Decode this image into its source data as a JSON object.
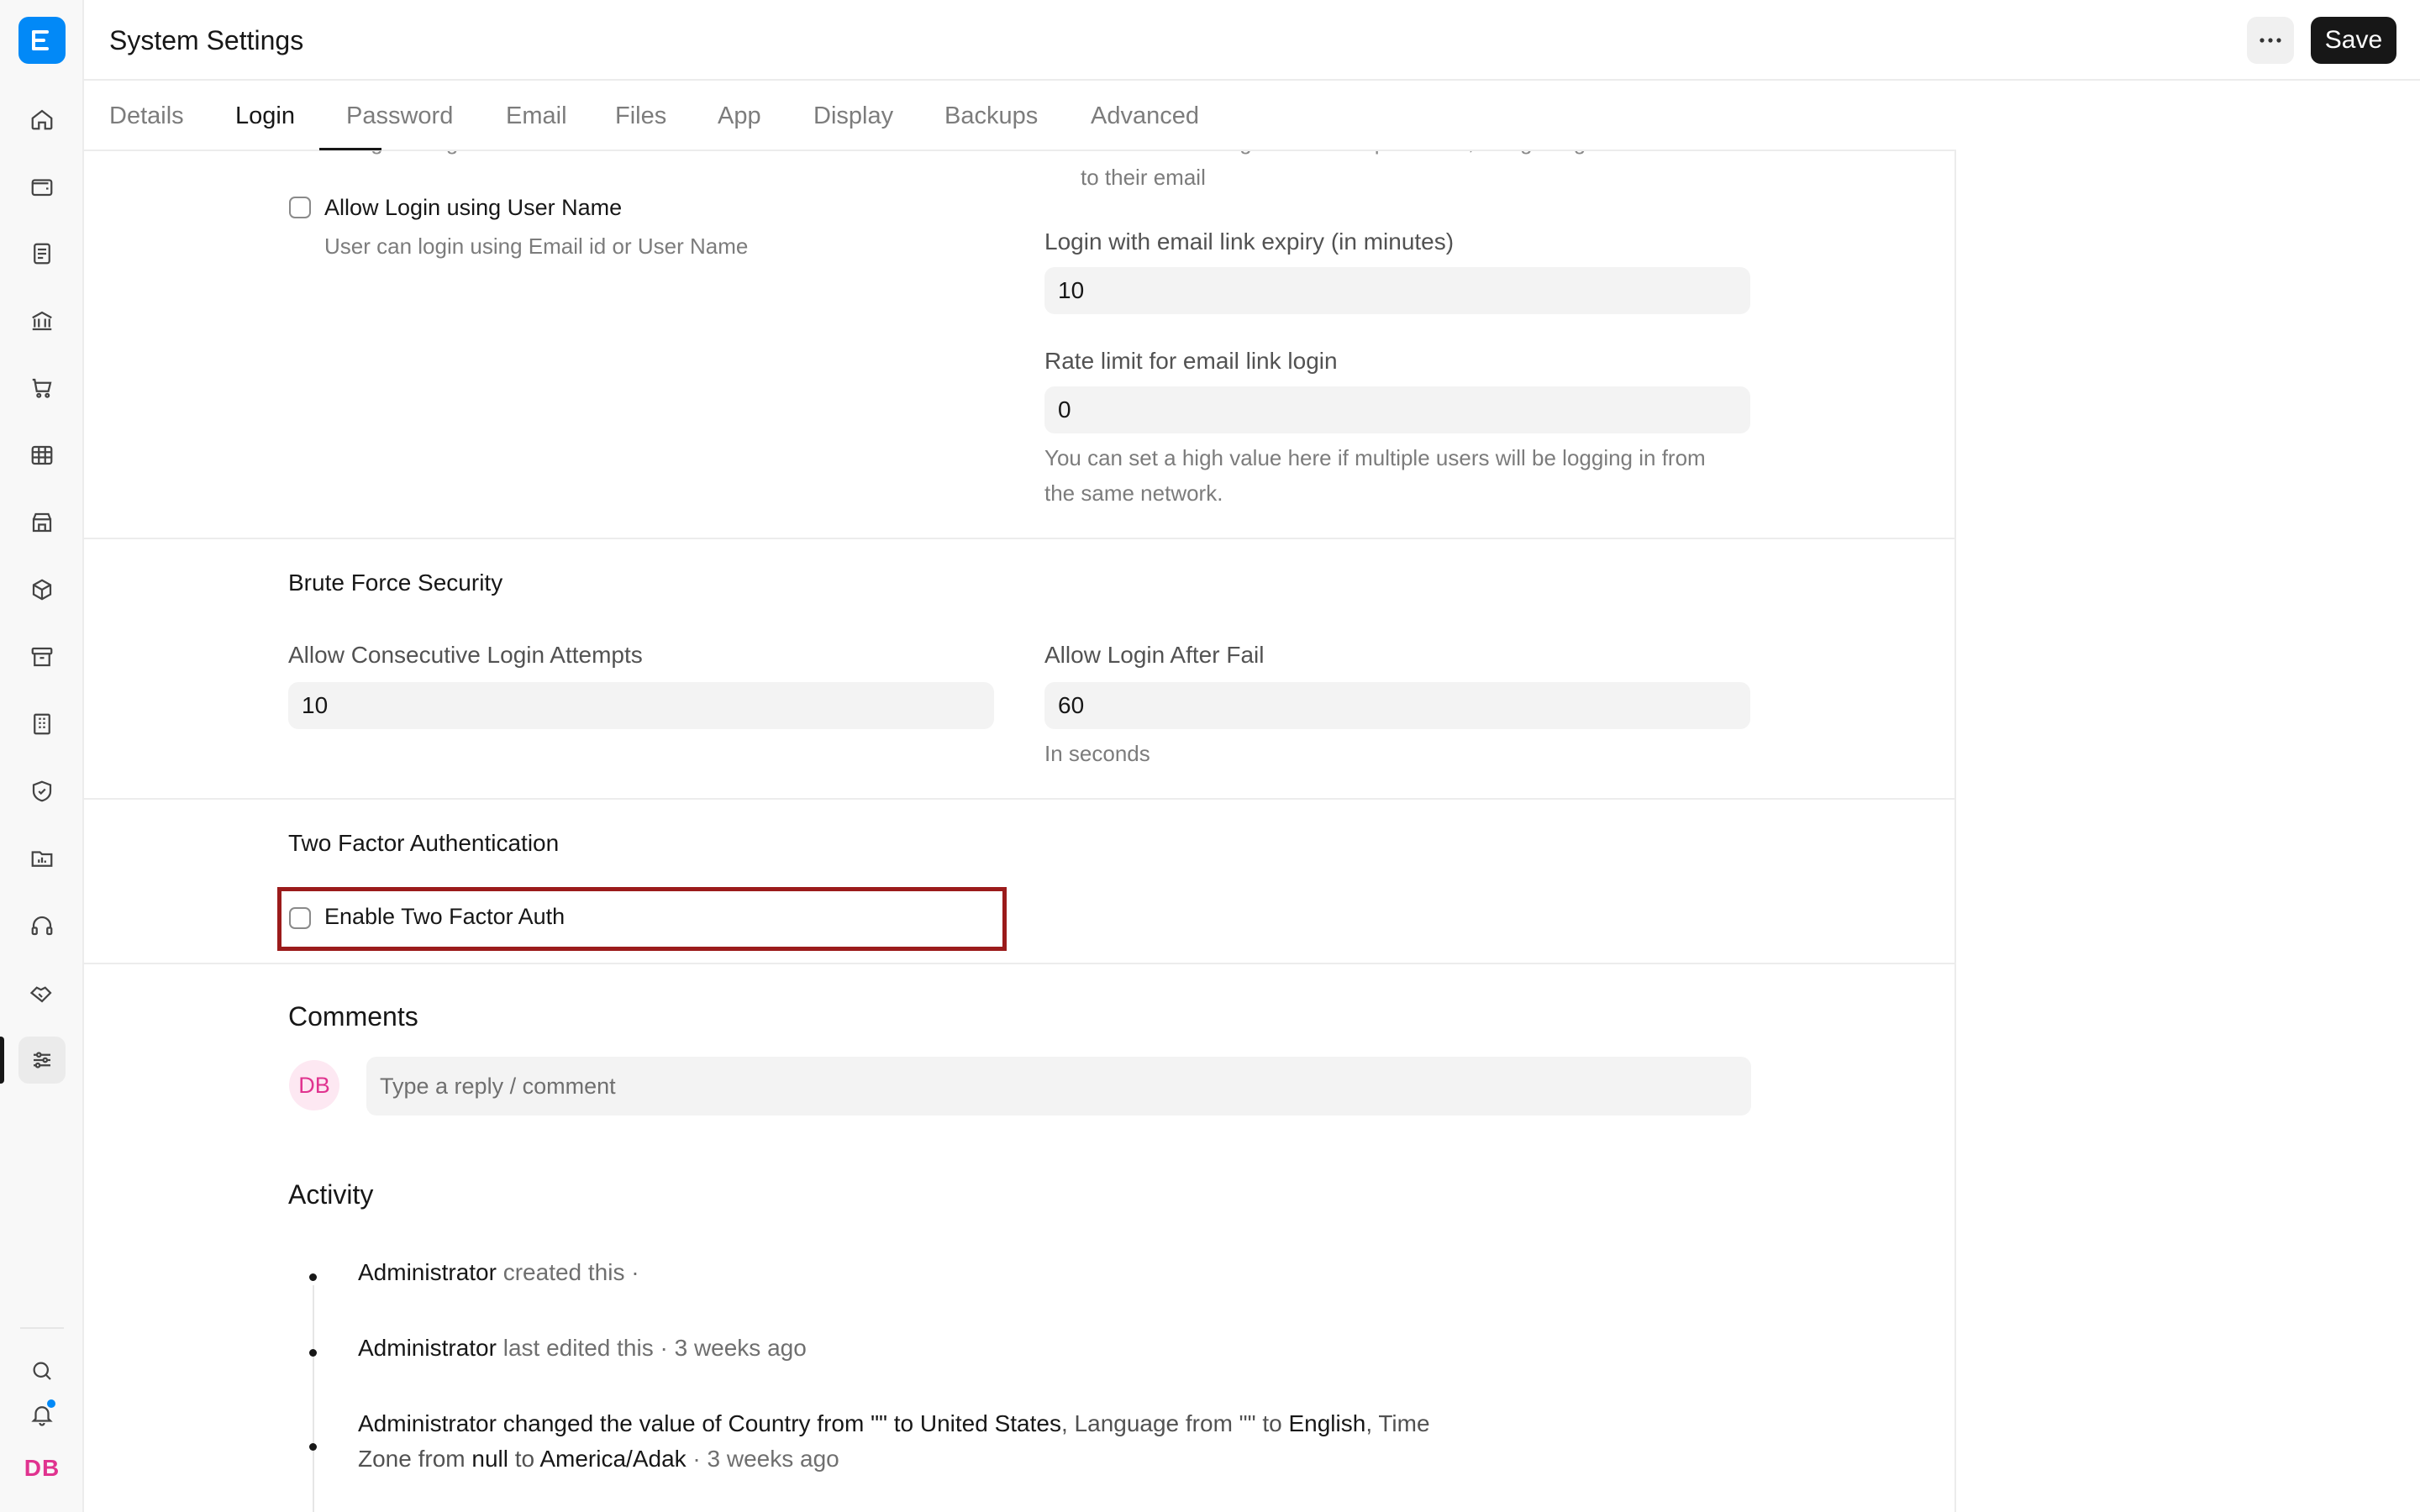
{
  "rail": {
    "avatar_initials": "DB",
    "items": [
      {
        "name": "home-icon"
      },
      {
        "name": "wallet-icon"
      },
      {
        "name": "document-icon"
      },
      {
        "name": "bank-icon"
      },
      {
        "name": "cart-icon"
      },
      {
        "name": "table-icon"
      },
      {
        "name": "store-icon"
      },
      {
        "name": "package-icon"
      },
      {
        "name": "archive-icon"
      },
      {
        "name": "building-icon"
      },
      {
        "name": "shield-icon"
      },
      {
        "name": "folder-chart-icon"
      },
      {
        "name": "headset-icon"
      },
      {
        "name": "handshake-icon"
      },
      {
        "name": "sliders-icon"
      }
    ],
    "bottom": [
      {
        "name": "search-icon"
      },
      {
        "name": "bell-icon"
      }
    ]
  },
  "header": {
    "title": "System Settings",
    "save_label": "Save"
  },
  "tabs": [
    "Details",
    "Login",
    "Password",
    "Email",
    "Files",
    "App",
    "Display",
    "Backups",
    "Advanced"
  ],
  "active_tab": "Login",
  "login": {
    "cropped_left_text": "Allow Login using Mobile Number",
    "cropped_right_text": "Allow users to log in without a password, using a login link sent",
    "right_help_tail": "to their email",
    "allow_username_label": "Allow Login using User Name",
    "allow_username_help": "User can login using Email id or User Name",
    "email_link_expiry_label": "Login with email link expiry (in minutes)",
    "email_link_expiry_value": "10",
    "rate_limit_label": "Rate limit for email link login",
    "rate_limit_value": "0",
    "rate_limit_help_1": "You can set a high value here if multiple users will be logging in from",
    "rate_limit_help_2": "the same network."
  },
  "brute_force": {
    "title": "Brute Force Security",
    "attempts_label": "Allow Consecutive Login Attempts",
    "attempts_value": "10",
    "after_fail_label": "Allow Login After Fail",
    "after_fail_value": "60",
    "after_fail_help": "In seconds"
  },
  "two_factor": {
    "title": "Two Factor Authentication",
    "enable_label": "Enable Two Factor Auth",
    "enabled": false,
    "highlight_color": "#9b1b1b"
  },
  "comments": {
    "title": "Comments",
    "avatar": "DB",
    "placeholder": "Type a reply / comment"
  },
  "activity": {
    "title": "Activity",
    "items": [
      {
        "actor": "Administrator",
        "text": "created this ·"
      },
      {
        "actor": "Administrator",
        "text": "last edited this · 3 weeks ago"
      },
      {
        "line1_a": "Administrator changed the value of Country from \"\" to ",
        "line1_b": "United States",
        "line1_c": ", Language from \"\" to ",
        "line1_d": "English",
        "line1_e": ", Time",
        "line2_a": "Zone from ",
        "line2_b": "null",
        "line2_c": " to ",
        "line2_d": "America/Adak",
        "line2_e": " · 3 weeks ago"
      }
    ]
  },
  "colors": {
    "brand": "#0289f7",
    "save_bg": "#171717",
    "avatar_text": "#e0338f"
  }
}
